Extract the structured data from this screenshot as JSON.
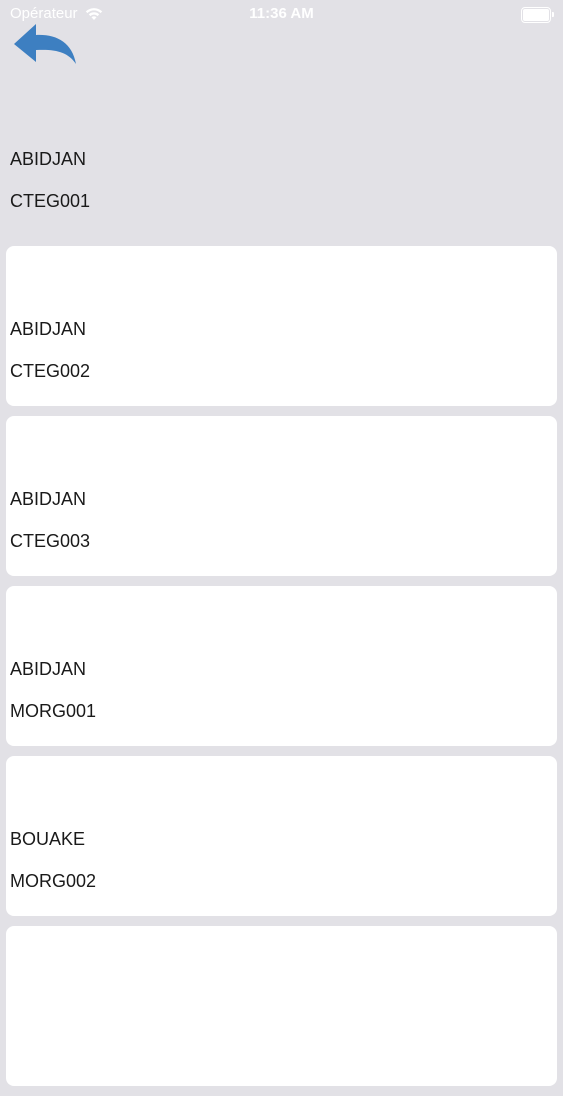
{
  "status_bar": {
    "carrier": "Opérateur",
    "time": "11:36 AM",
    "wifi_icon": "wifi-icon",
    "battery_icon": "battery-icon"
  },
  "nav": {
    "back_icon": "back-arrow-icon",
    "accent_color": "#3d7fc1"
  },
  "items": [
    {
      "city": "ABIDJAN",
      "code": "CTEG001",
      "selected": true
    },
    {
      "city": "ABIDJAN",
      "code": "CTEG002",
      "selected": false
    },
    {
      "city": "ABIDJAN",
      "code": "CTEG003",
      "selected": false
    },
    {
      "city": "ABIDJAN",
      "code": "MORG001",
      "selected": false
    },
    {
      "city": "BOUAKE",
      "code": "MORG002",
      "selected": false
    },
    {
      "city": "",
      "code": "",
      "selected": false
    }
  ],
  "colors": {
    "background": "#e2e1e6",
    "card": "#ffffff",
    "text": "#1a1a1a"
  }
}
